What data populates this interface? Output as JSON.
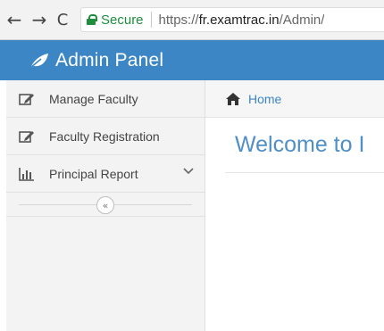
{
  "browser": {
    "back_label": "←",
    "forward_label": "→",
    "reload_label": "C",
    "secure_label": "Secure",
    "url_prefix": "https://",
    "url_host": "fr.examtrac.in",
    "url_path": "/Admin/"
  },
  "header": {
    "title": "Admin Panel",
    "logo_icon": "leaf-icon",
    "background": "#3d86c6"
  },
  "sidebar": {
    "items": [
      {
        "label": "Manage Faculty",
        "icon": "edit-icon"
      },
      {
        "label": "Faculty Registration",
        "icon": "edit-icon"
      },
      {
        "label": "Principal Report",
        "icon": "bar-chart-icon",
        "has_submenu": true
      }
    ],
    "collapse_label": "«"
  },
  "breadcrumb": {
    "home_label": "Home"
  },
  "main": {
    "welcome_text": "Welcome to I"
  }
}
